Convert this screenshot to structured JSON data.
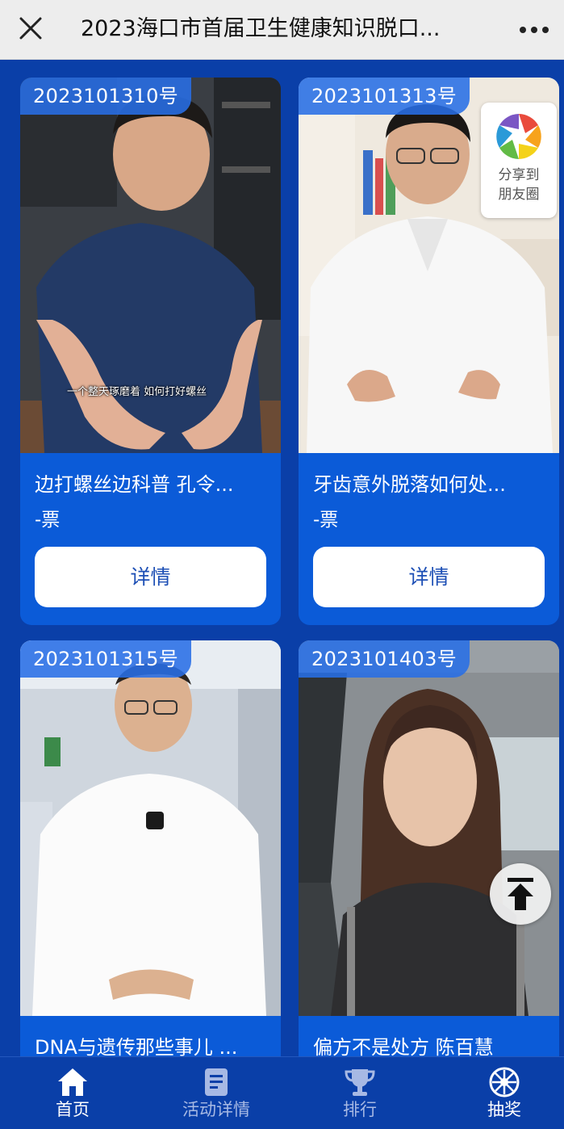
{
  "header": {
    "title": "2023海口市首届卫生健康知识脱口...",
    "close_icon": "close-icon",
    "more_icon": "more-dots-icon"
  },
  "cards": [
    {
      "badge": "2023101310号",
      "subtitle": "一个整天琢磨着 如何打好螺丝",
      "title": "边打螺丝边科普 孔令...",
      "votes": "-票",
      "detail_label": "详情"
    },
    {
      "badge": "2023101313号",
      "title": "牙齿意外脱落如何处...",
      "votes": "-票",
      "detail_label": "详情"
    },
    {
      "badge": "2023101315号",
      "title": "DNA与遗传那些事儿 ..."
    },
    {
      "badge": "2023101403号",
      "title": "偏方不是处方 陈百慧"
    }
  ],
  "share": {
    "icon": "camera-aperture-icon",
    "label_line1": "分享到",
    "label_line2": "朋友圈"
  },
  "back_to_top": {
    "icon": "arrow-up-icon"
  },
  "tabbar": {
    "items": [
      {
        "label": "首页",
        "icon": "home-icon",
        "active": true
      },
      {
        "label": "活动详情",
        "icon": "notebook-icon",
        "active": false
      },
      {
        "label": "排行",
        "icon": "trophy-icon",
        "active": false
      },
      {
        "label": "抽奖",
        "icon": "prize-wheel-icon",
        "active": false
      }
    ]
  }
}
